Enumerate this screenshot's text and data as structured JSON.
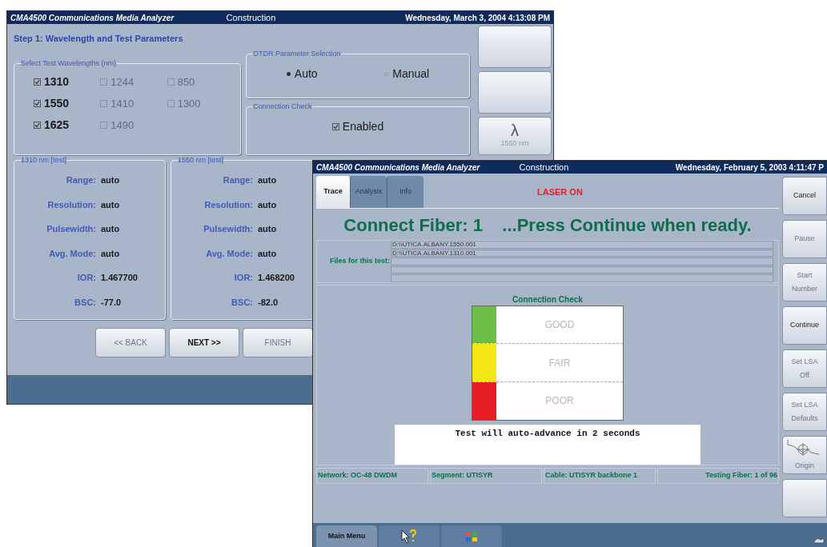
{
  "setup_window": {
    "title": "CMA4500 Communications Media Analyzer",
    "mode": "Construction",
    "datetime": "Wednesday, March 3, 2004 4:13:08 PM",
    "step_title": "Step 1: Wavelength and Test Parameters",
    "wavelength_group": {
      "legend": "Select Test Wavelengths (nm)",
      "wavelengths": [
        {
          "label": "1310",
          "checked": true
        },
        {
          "label": "1244",
          "checked": false
        },
        {
          "label": "850",
          "checked": false
        },
        {
          "label": "1550",
          "checked": true
        },
        {
          "label": "1410",
          "checked": false
        },
        {
          "label": "1300",
          "checked": false
        },
        {
          "label": "1625",
          "checked": true
        },
        {
          "label": "1490",
          "checked": false
        }
      ]
    },
    "otdr_group": {
      "legend": "OTDR Parameter Selection",
      "options": [
        {
          "label": "Auto",
          "selected": true
        },
        {
          "label": "Manual",
          "selected": false
        }
      ]
    },
    "connection_group": {
      "legend": "Connection Check",
      "label": "Enabled",
      "checked": true
    },
    "parameter_groups": [
      {
        "legend": "1310 nm [test]",
        "rows": [
          {
            "label": "Range:",
            "value": "auto"
          },
          {
            "label": "Resolution:",
            "value": "auto"
          },
          {
            "label": "Pulsewidth:",
            "value": "auto"
          },
          {
            "label": "Avg. Mode:",
            "value": "auto"
          },
          {
            "label": "IOR:",
            "value": "1.467700"
          },
          {
            "label": "BSC:",
            "value": "-77.0"
          }
        ]
      },
      {
        "legend": "1550 nm [test]",
        "rows": [
          {
            "label": "Range:",
            "value": "auto"
          },
          {
            "label": "Resolution:",
            "value": "auto"
          },
          {
            "label": "Pulsewidth:",
            "value": "auto"
          },
          {
            "label": "Avg. Mode:",
            "value": "auto"
          },
          {
            "label": "IOR:",
            "value": "1.468200"
          },
          {
            "label": "BSC:",
            "value": "-82.0"
          }
        ]
      }
    ],
    "nav_buttons": [
      {
        "label": "<< BACK",
        "disabled": true
      },
      {
        "label": "NEXT >>",
        "disabled": false
      },
      {
        "label": "FINISH",
        "disabled": true
      }
    ],
    "side_buttons": [
      {
        "kind": "blank"
      },
      {
        "kind": "blank"
      },
      {
        "kind": "wavelength",
        "symbol": "λ",
        "label": "1550 nm"
      }
    ]
  },
  "test_window": {
    "title": "CMA4500 Communications Media Analyzer",
    "mode": "Construction",
    "datetime": "Wednesday, February 5, 2003 4:11:47 P",
    "tabs": [
      {
        "label": "Trace",
        "selected": true
      },
      {
        "label": "Analysis",
        "selected": false
      },
      {
        "label": "Info",
        "selected": false
      }
    ],
    "laser_status": "LASER ON",
    "prompt": "Connect Fiber: 1    ...Press Continue when ready.",
    "files_label": "Files for this test:",
    "files": [
      "D:\\\\UTICA.ALBANY.1550.001",
      "D:\\\\UTICA.ALBANY.1310.001"
    ],
    "connection_check": {
      "title": "Connection Check",
      "levels": [
        {
          "label": "GOOD",
          "color": "#6cbd45"
        },
        {
          "label": "FAIR",
          "color": "#f5e616"
        },
        {
          "label": "POOR",
          "color": "#e81e25"
        }
      ]
    },
    "message": "Test will auto-advance in 2 seconds",
    "status_bar": [
      "Network: OC-48 DWDM",
      "Segment: UTISYR",
      "Cable: UTISYR backbone 1",
      "Testing Fiber: 1 of 96"
    ],
    "side_buttons": [
      {
        "kind": "text",
        "lines": [
          "Cancel"
        ],
        "disabled": false
      },
      {
        "kind": "text",
        "lines": [
          "Pause"
        ],
        "disabled": true
      },
      {
        "kind": "text",
        "lines": [
          "Start",
          "Number"
        ],
        "disabled": true
      },
      {
        "kind": "text",
        "lines": [
          "Continue"
        ],
        "disabled": false
      },
      {
        "kind": "text",
        "lines": [
          "Set LSA",
          "Off"
        ],
        "disabled": true
      },
      {
        "kind": "text",
        "lines": [
          "Set LSA",
          "Defaults"
        ],
        "disabled": true
      },
      {
        "kind": "origin",
        "lines": [
          "Origin"
        ],
        "disabled": true
      },
      {
        "kind": "blank"
      }
    ],
    "taskbar": [
      {
        "kind": "text",
        "label": "Main Menu"
      },
      {
        "kind": "help"
      },
      {
        "kind": "flag"
      }
    ]
  }
}
